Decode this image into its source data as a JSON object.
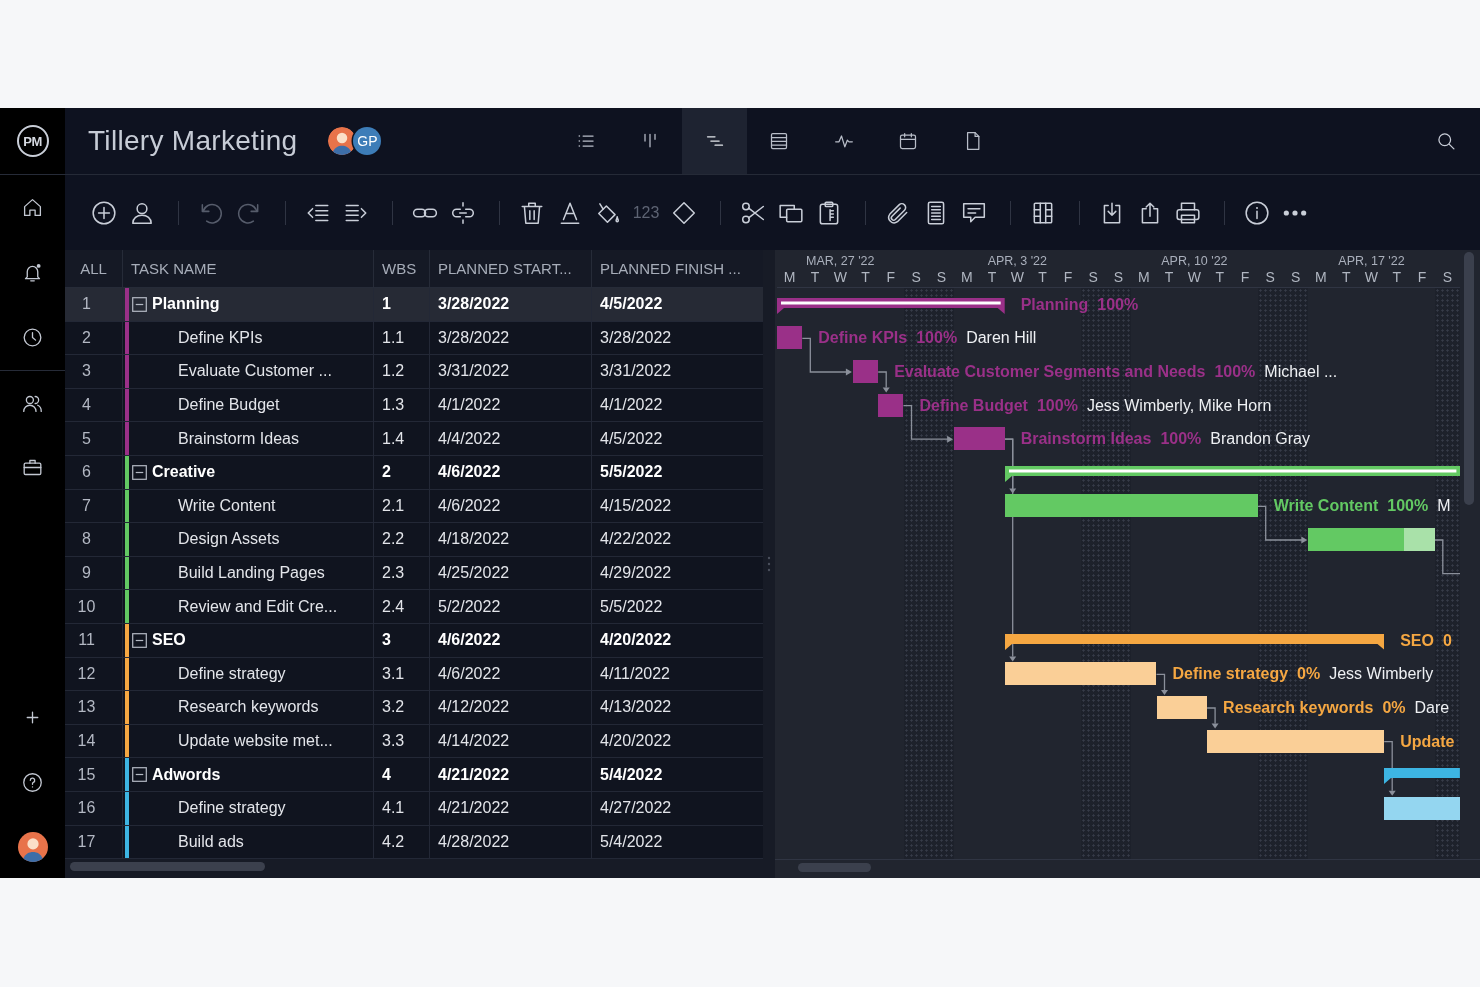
{
  "app": {
    "logo": "PM",
    "title": "Tillery Marketing",
    "members": [
      {
        "kind": "avatar"
      },
      {
        "kind": "initials",
        "initials": "GP"
      }
    ],
    "views": [
      {
        "kind": "list",
        "selected": false
      },
      {
        "kind": "board",
        "selected": false
      },
      {
        "kind": "gantt",
        "selected": true
      },
      {
        "kind": "sheet",
        "selected": false
      },
      {
        "kind": "dashboard",
        "selected": false
      },
      {
        "kind": "calendar",
        "selected": false
      },
      {
        "kind": "files",
        "selected": false
      }
    ]
  },
  "toolbar": {
    "groups": [
      {
        "items": [
          {
            "kind": "add",
            "disabled": false
          },
          {
            "kind": "assign",
            "disabled": false
          }
        ]
      },
      {
        "items": [
          {
            "kind": "undo",
            "disabled": true
          },
          {
            "kind": "redo",
            "disabled": true
          }
        ]
      },
      {
        "items": [
          {
            "kind": "outdent",
            "disabled": false
          },
          {
            "kind": "indent",
            "disabled": false
          }
        ]
      },
      {
        "items": [
          {
            "kind": "link",
            "disabled": false
          },
          {
            "kind": "unlink",
            "disabled": false
          }
        ]
      },
      {
        "items": [
          {
            "kind": "delete",
            "disabled": false
          },
          {
            "kind": "font",
            "disabled": false
          },
          {
            "kind": "fill",
            "disabled": false
          },
          {
            "kind": "number",
            "label": "123",
            "disabled": true
          },
          {
            "kind": "milestone",
            "disabled": false
          }
        ]
      },
      {
        "items": [
          {
            "kind": "cut",
            "disabled": false
          },
          {
            "kind": "copy",
            "disabled": false
          },
          {
            "kind": "paste",
            "disabled": false
          }
        ]
      },
      {
        "items": [
          {
            "kind": "attach",
            "disabled": false
          },
          {
            "kind": "notes",
            "disabled": false
          },
          {
            "kind": "comment",
            "disabled": false
          }
        ]
      },
      {
        "items": [
          {
            "kind": "columns",
            "disabled": false
          }
        ]
      },
      {
        "items": [
          {
            "kind": "import",
            "disabled": false
          },
          {
            "kind": "export",
            "disabled": false
          },
          {
            "kind": "print",
            "disabled": false
          }
        ]
      },
      {
        "items": [
          {
            "kind": "info",
            "disabled": false
          },
          {
            "kind": "more",
            "disabled": false
          }
        ]
      }
    ]
  },
  "table": {
    "columns": [
      "ALL",
      "TASK NAME",
      "WBS",
      "PLANNED START...",
      "PLANNED FINISH ..."
    ],
    "rows": [
      {
        "num": "1",
        "name": "Planning",
        "wbs": "1",
        "start": "3/28/2022",
        "finish": "4/5/2022",
        "color": "#9a3088",
        "expanded": true,
        "selected": true,
        "bar": {
          "level": 1,
          "label": "Planning",
          "percent": "100%"
        },
        "children": [
          {
            "num": "2",
            "name": "Define KPIs",
            "wbs": "1.1",
            "start": "3/28/2022",
            "finish": "3/28/2022",
            "selected": false,
            "bar": {
              "level": 1,
              "label": "Define KPIs",
              "percent": "100%",
              "assignee": "Daren Hill"
            }
          },
          {
            "num": "3",
            "name": "Evaluate Customer ...",
            "wbs": "1.2",
            "start": "3/31/2022",
            "finish": "3/31/2022",
            "selected": false,
            "bar": {
              "level": 1,
              "label": "Evaluate Customer Segments and Needs",
              "percent": "100%",
              "assignee": "Michael ..."
            }
          },
          {
            "num": "4",
            "name": "Define Budget",
            "wbs": "1.3",
            "start": "4/1/2022",
            "finish": "4/1/2022",
            "selected": false,
            "bar": {
              "level": 1,
              "label": "Define Budget",
              "percent": "100%",
              "assignee": "Jess Wimberly, Mike Horn"
            }
          },
          {
            "num": "5",
            "name": "Brainstorm Ideas",
            "wbs": "1.4",
            "start": "4/4/2022",
            "finish": "4/5/2022",
            "selected": false,
            "bar": {
              "level": 1,
              "label": "Brainstorm Ideas",
              "percent": "100%",
              "assignee": "Brandon Gray"
            }
          }
        ]
      },
      {
        "num": "6",
        "name": "Creative",
        "wbs": "2",
        "start": "4/6/2022",
        "finish": "5/5/2022",
        "color": "#63c963",
        "expanded": true,
        "selected": false,
        "bar": {
          "level": 1
        },
        "children": [
          {
            "num": "7",
            "name": "Write Content",
            "wbs": "2.1",
            "start": "4/6/2022",
            "finish": "4/15/2022",
            "selected": false,
            "bar": {
              "level": 1,
              "label": "Write Content",
              "percent": "100%",
              "assignee": "M"
            }
          },
          {
            "num": "8",
            "name": "Design Assets",
            "wbs": "2.2",
            "start": "4/18/2022",
            "finish": "4/22/2022",
            "selected": false,
            "bar": {
              "level": 0.76
            }
          },
          {
            "num": "9",
            "name": "Build Landing Pages",
            "wbs": "2.3",
            "start": "4/25/2022",
            "finish": "4/29/2022",
            "selected": false
          },
          {
            "num": "10",
            "name": "Review and Edit Cre...",
            "wbs": "2.4",
            "start": "5/2/2022",
            "finish": "5/5/2022",
            "selected": false
          }
        ]
      },
      {
        "num": "11",
        "name": "SEO",
        "wbs": "3",
        "start": "4/6/2022",
        "finish": "4/20/2022",
        "color": "#f5a742",
        "expanded": true,
        "selected": false,
        "bar": {
          "label": "SEO",
          "percent": "0"
        },
        "children": [
          {
            "num": "12",
            "name": "Define strategy",
            "wbs": "3.1",
            "start": "4/6/2022",
            "finish": "4/11/2022",
            "selected": false,
            "bar": {
              "label": "Define strategy",
              "percent": "0%",
              "assignee": "Jess Wimberly"
            }
          },
          {
            "num": "13",
            "name": "Research keywords",
            "wbs": "3.2",
            "start": "4/12/2022",
            "finish": "4/13/2022",
            "selected": false,
            "bar": {
              "label": "Research keywords",
              "percent": "0%",
              "assignee": "Dare"
            }
          },
          {
            "num": "14",
            "name": "Update website met...",
            "wbs": "3.3",
            "start": "4/14/2022",
            "finish": "4/20/2022",
            "selected": false,
            "bar": {
              "label": "Update"
            }
          }
        ]
      },
      {
        "num": "15",
        "name": "Adwords",
        "wbs": "4",
        "start": "4/21/2022",
        "finish": "5/4/2022",
        "color": "#3db5e3",
        "expanded": true,
        "selected": false,
        "children": [
          {
            "num": "16",
            "name": "Define strategy",
            "wbs": "4.1",
            "start": "4/21/2022",
            "finish": "4/27/2022",
            "selected": false
          },
          {
            "num": "17",
            "name": "Build ads",
            "wbs": "4.2",
            "start": "4/28/2022",
            "finish": "5/4/2022",
            "selected": false
          }
        ]
      }
    ]
  },
  "gantt": {
    "weeks": [
      "MAR, 27 '22",
      "APR, 3 '22",
      "APR, 10 '22",
      "APR, 17 '22"
    ],
    "days": [
      {
        "label": "M",
        "weekend": false
      },
      {
        "label": "T",
        "weekend": false
      },
      {
        "label": "W",
        "weekend": false
      },
      {
        "label": "T",
        "weekend": false
      },
      {
        "label": "F",
        "weekend": false
      },
      {
        "label": "S",
        "weekend": true
      },
      {
        "label": "S",
        "weekend": true
      },
      {
        "label": "M",
        "weekend": false
      },
      {
        "label": "T",
        "weekend": false
      },
      {
        "label": "W",
        "weekend": false
      },
      {
        "label": "T",
        "weekend": false
      },
      {
        "label": "F",
        "weekend": false
      },
      {
        "label": "S",
        "weekend": true
      },
      {
        "label": "S",
        "weekend": true
      },
      {
        "label": "M",
        "weekend": false
      },
      {
        "label": "T",
        "weekend": false
      },
      {
        "label": "W",
        "weekend": false
      },
      {
        "label": "T",
        "weekend": false
      },
      {
        "label": "F",
        "weekend": false
      },
      {
        "label": "S",
        "weekend": true
      },
      {
        "label": "S",
        "weekend": true
      },
      {
        "label": "M",
        "weekend": false
      },
      {
        "label": "T",
        "weekend": false
      },
      {
        "label": "W",
        "weekend": false
      },
      {
        "label": "T",
        "weekend": false
      },
      {
        "label": "F",
        "weekend": false
      },
      {
        "label": "S",
        "weekend": true
      }
    ]
  }
}
